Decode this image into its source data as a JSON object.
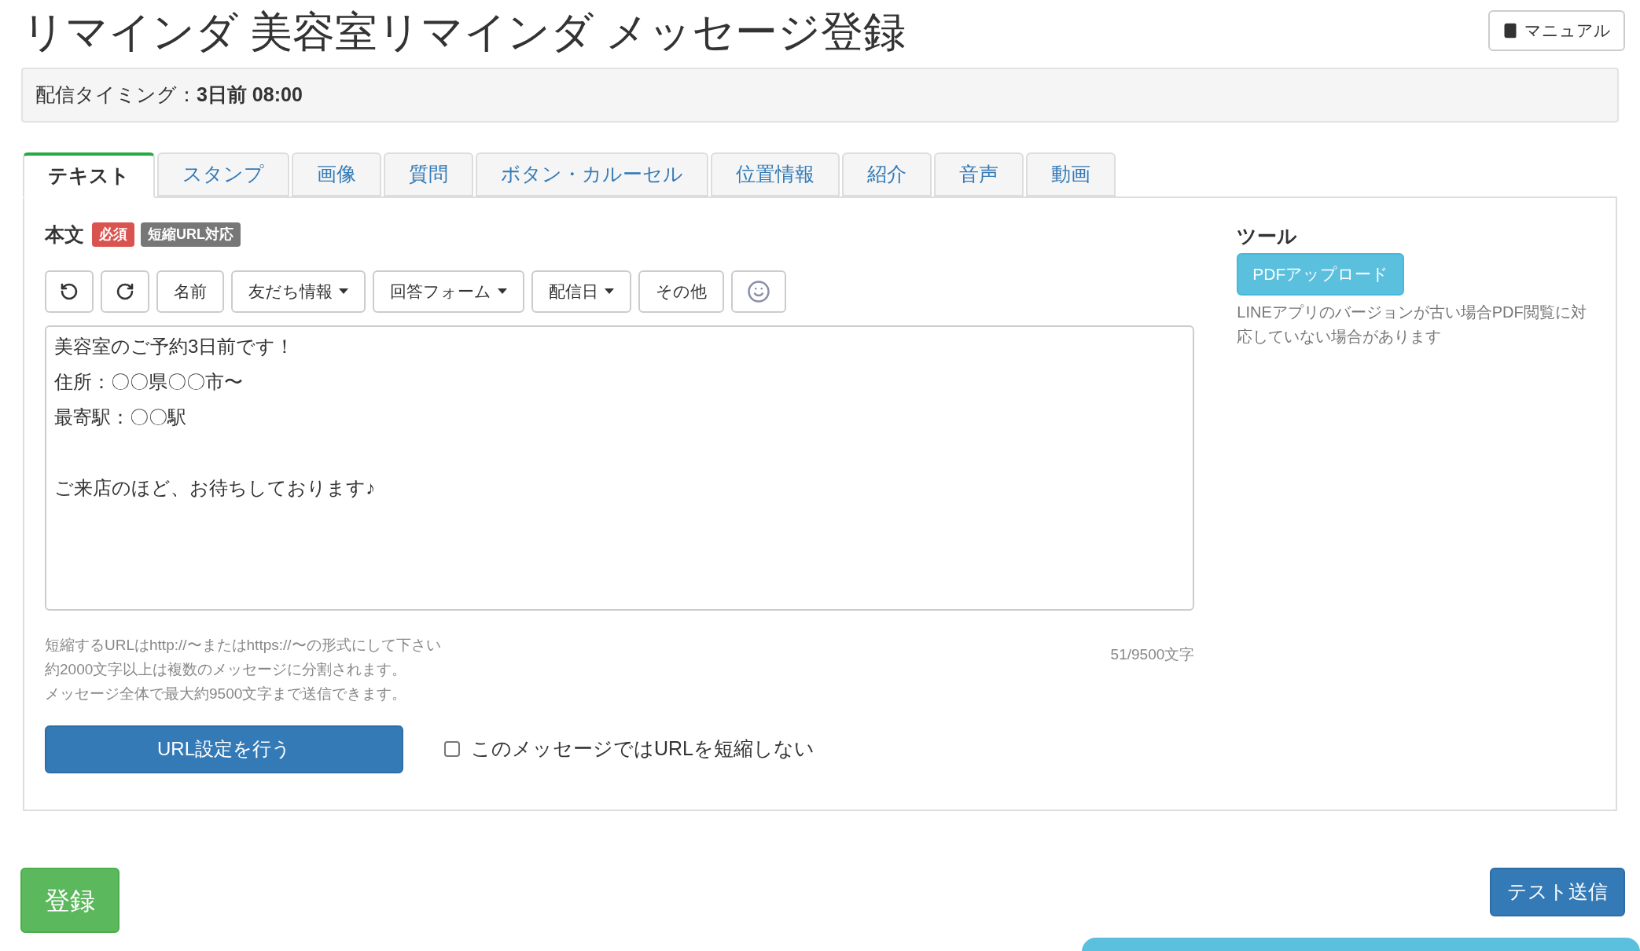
{
  "title": "リマインダ 美容室リマインダ メッセージ登録",
  "manual_button": "マニュアル",
  "timing": {
    "label": "配信タイミング：",
    "value": "3日前 08:00"
  },
  "tabs": [
    {
      "label": "テキスト",
      "selected": true
    },
    {
      "label": "スタンプ",
      "selected": false
    },
    {
      "label": "画像",
      "selected": false
    },
    {
      "label": "質問",
      "selected": false
    },
    {
      "label": "ボタン・カルーセル",
      "selected": false
    },
    {
      "label": "位置情報",
      "selected": false
    },
    {
      "label": "紹介",
      "selected": false
    },
    {
      "label": "音声",
      "selected": false
    },
    {
      "label": "動画",
      "selected": false
    }
  ],
  "body": {
    "label": "本文",
    "badges": [
      {
        "text": "必須",
        "color": "#d9534f"
      },
      {
        "text": "短縮URL対応",
        "color": "#777777"
      }
    ]
  },
  "toolbar": [
    {
      "kind": "undo"
    },
    {
      "kind": "redo"
    },
    {
      "kind": "text",
      "label": "名前"
    },
    {
      "kind": "dropdown",
      "label": "友だち情報"
    },
    {
      "kind": "dropdown",
      "label": "回答フォーム"
    },
    {
      "kind": "dropdown",
      "label": "配信日"
    },
    {
      "kind": "text",
      "label": "その他"
    },
    {
      "kind": "emoji"
    }
  ],
  "message_paragraphs": [
    [
      "美容室のご予約3日前です！",
      "住所：〇〇県〇〇市〜",
      "最寄駅：〇〇駅"
    ],
    [
      "ご来店のほど、お待ちしております♪"
    ]
  ],
  "hints": [
    "短縮するURLはhttp://〜またはhttps://〜の形式にして下さい",
    "約2000文字以上は複数のメッセージに分割されます。",
    "メッセージ全体で最大約9500文字まで送信できます。"
  ],
  "char_count": "51/9500文字",
  "url_button": "URL設定を行う",
  "no_shorten": {
    "label": "このメッセージではURLを短縮しない",
    "checked": false
  },
  "tools": {
    "title": "ツール",
    "button": "PDFアップロード",
    "note": "LINEアプリのバージョンが古い場合PDF閲覧に対応していない場合があります"
  },
  "register_button": "登録",
  "test_send_button": "テスト送信"
}
